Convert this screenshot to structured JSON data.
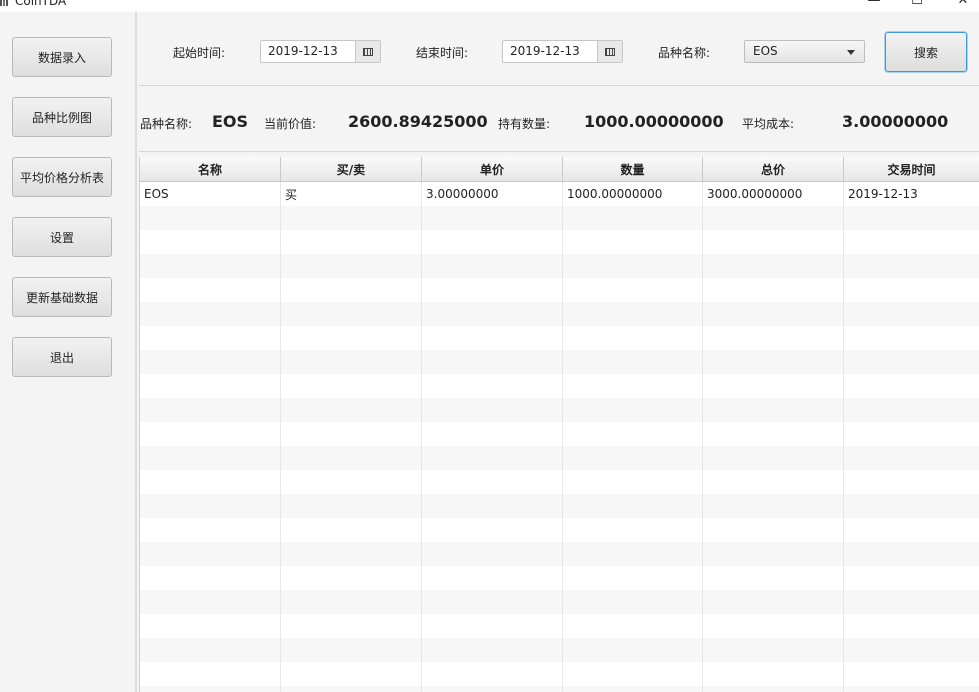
{
  "window": {
    "title": "CoinTDA",
    "controls": [
      "—",
      "☐",
      "✕"
    ]
  },
  "sidebar": {
    "items": [
      {
        "label": "数据录入"
      },
      {
        "label": "品种比例图"
      },
      {
        "label": "平均价格分析表"
      },
      {
        "label": "设置"
      },
      {
        "label": "更新基础数据"
      },
      {
        "label": "退出"
      }
    ]
  },
  "search": {
    "start_label": "起始时间:",
    "start_value": "2019-12-13",
    "end_label": "结束时间:",
    "end_value": "2019-12-13",
    "variety_label": "品种名称:",
    "variety_value": "EOS",
    "button_label": "搜索"
  },
  "summary": {
    "variety_label": "品种名称:",
    "variety_value": "EOS",
    "price_label": "当前价值:",
    "price_value": "2600.89425000",
    "qty_label": "持有数量:",
    "qty_value": "1000.00000000",
    "cost_label": "平均成本:",
    "cost_value": "3.00000000"
  },
  "table": {
    "columns": [
      "名称",
      "买/卖",
      "单价",
      "数量",
      "总价",
      "交易时间"
    ],
    "rows": [
      [
        "EOS",
        "买",
        "3.00000000",
        "1000.00000000",
        "3000.00000000",
        "2019-12-13"
      ]
    ]
  },
  "colors": {
    "focus_border": "#3d9ad6",
    "stripe": "#f7f7f7"
  }
}
